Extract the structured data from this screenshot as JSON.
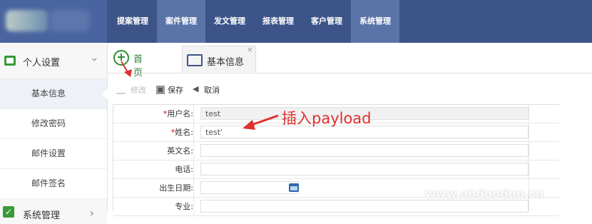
{
  "nav": {
    "items": [
      "提案管理",
      "案件管理",
      "发文管理",
      "报表管理",
      "客户管理",
      "系统管理"
    ],
    "active_indexes": [
      1,
      5
    ]
  },
  "sidebar": {
    "section_title": "个人设置",
    "items": [
      "基本信息",
      "修改密码",
      "邮件设置",
      "邮件签名"
    ],
    "active_item": "基本信息",
    "next_section_title": "系统管理"
  },
  "tabs": {
    "home_label": "首页",
    "basic_label": "基本信息",
    "close_glyph": "×"
  },
  "toolbar": {
    "edit_label": "修改",
    "save_label": "保存",
    "cancel_label": "取消"
  },
  "form": {
    "fields": [
      {
        "label": "用户名:",
        "required": true,
        "value": "test",
        "readonly": true
      },
      {
        "label": "姓名:",
        "required": true,
        "value": "test'",
        "readonly": false
      },
      {
        "label": "英文名:",
        "required": false,
        "value": "",
        "readonly": false
      },
      {
        "label": "电话:",
        "required": false,
        "value": "",
        "readonly": false
      },
      {
        "label": "出生日期:",
        "required": false,
        "value": "",
        "readonly": false
      },
      {
        "label": "专业:",
        "required": false,
        "value": "",
        "readonly": false
      }
    ]
  },
  "annotation": {
    "text": "插入payload",
    "color": "#e0312e"
  },
  "watermark": "www.ahduoduo.cn",
  "colors": {
    "nav_bg": "#3c5488",
    "nav_active": "#5a74a8",
    "home_green": "#2e7d32"
  }
}
